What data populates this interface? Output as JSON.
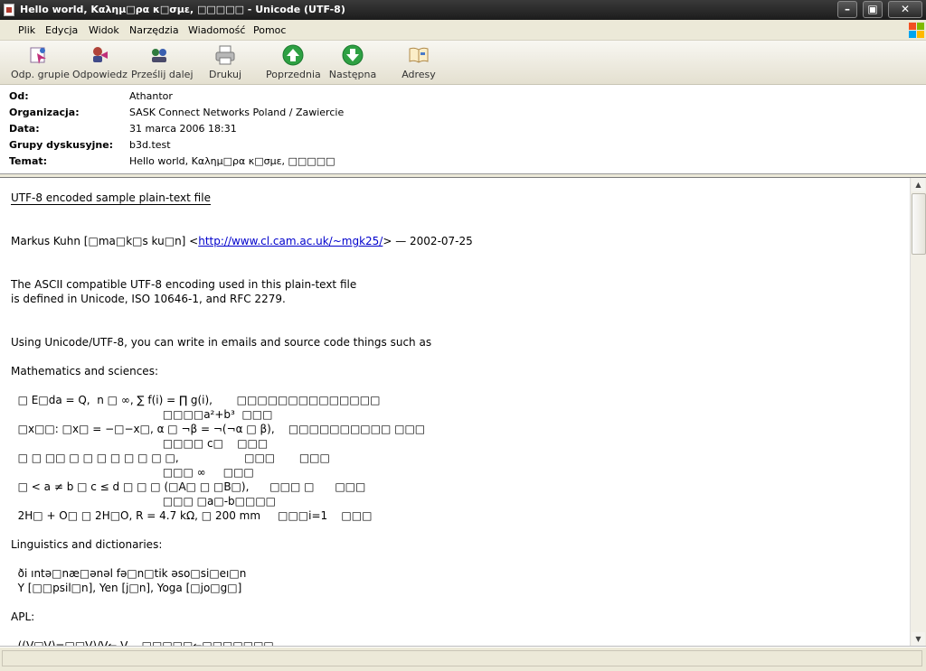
{
  "window": {
    "title": "Hello world, Καλημ□ρα κ□σμε, □□□□□ - Unicode (UTF-8)",
    "minimize": "–",
    "maximize": "▣",
    "close": "✕"
  },
  "menu": [
    "Plik",
    "Edycja",
    "Widok",
    "Narzędzia",
    "Wiadomość",
    "Pomoc"
  ],
  "toolbar": [
    {
      "label": "Odp. grupie",
      "icon": "reply-group-icon"
    },
    {
      "label": "Odpowiedz",
      "icon": "reply-icon"
    },
    {
      "label": "Prześlij dalej",
      "icon": "forward-icon"
    },
    {
      "label": "Drukuj",
      "icon": "printer-icon"
    },
    {
      "label": "Poprzednia",
      "icon": "up-arrow-icon"
    },
    {
      "label": "Następna",
      "icon": "down-arrow-icon"
    },
    {
      "label": "Adresy",
      "icon": "address-book-icon"
    }
  ],
  "headers": [
    {
      "key": "Od:",
      "value": "Athantor"
    },
    {
      "key": "Organizacja:",
      "value": "SASK Connect Networks Poland / Zawiercie"
    },
    {
      "key": "Data:",
      "value": "31 marca 2006 18:31"
    },
    {
      "key": "Grupy dyskusyjne:",
      "value": "b3d.test"
    },
    {
      "key": "Temat:",
      "value": "Hello world, Καλημ□ρα κ□σμε, □□□□□"
    }
  ],
  "message": {
    "title": "UTF-8 encoded sample plain-text file",
    "author_pre": "Markus Kuhn [□ma□k□s ku□n] <",
    "author_link": "http://www.cl.cam.ac.uk/~mgk25/",
    "author_post": "> — 2002-07-25",
    "para1": [
      "The ASCII compatible UTF-8 encoding used in this plain-text file",
      "is defined in Unicode, ISO 10646-1, and RFC 2279."
    ],
    "using": "Using Unicode/UTF-8, you can write in emails and source code things such as",
    "math_heading": "Mathematics and sciences:",
    "math_lines": [
      "  □ E□da = Q,  n □ ∞, ∑ f(i) = ∏ g(i),       □□□□□□□□□□□□□□",
      "                                            □□□□a²+b³  □□□",
      "  □x□□: □x□ = −□−x□, α □ ¬β = ¬(¬α □ β),    □□□□□□□□□□ □□□",
      "                                            □□□□ c□    □□□",
      "  □ □ □□ □ □ □ □ □ □ □ □,                   □□□       □□□",
      "                                            □□□ ∞     □□□",
      "  □ < a ≠ b □ c ≤ d □ □ □ (□A□ □ □B□),      □□□ □      □□□",
      "                                            □□□ □a□-b□□□□",
      "  2H□ + O□ □ 2H□O, R = 4.7 kΩ, □ 200 mm     □□□i=1    □□□"
    ],
    "ling_heading": "Linguistics and dictionaries:",
    "ling_lines": [
      "  ði ıntə□næ□ənəl fə□n□tik əso□si□eı□n",
      "  Y [□□psil□n], Yen [j□n], Yoga [□jo□g□]"
    ],
    "apl_heading": "APL:",
    "apl_line": "  ((V□V)=□□V)/V←,V    □□□□□←□□□□□□□"
  },
  "scroll": {
    "up": "▲",
    "down": "▼"
  }
}
